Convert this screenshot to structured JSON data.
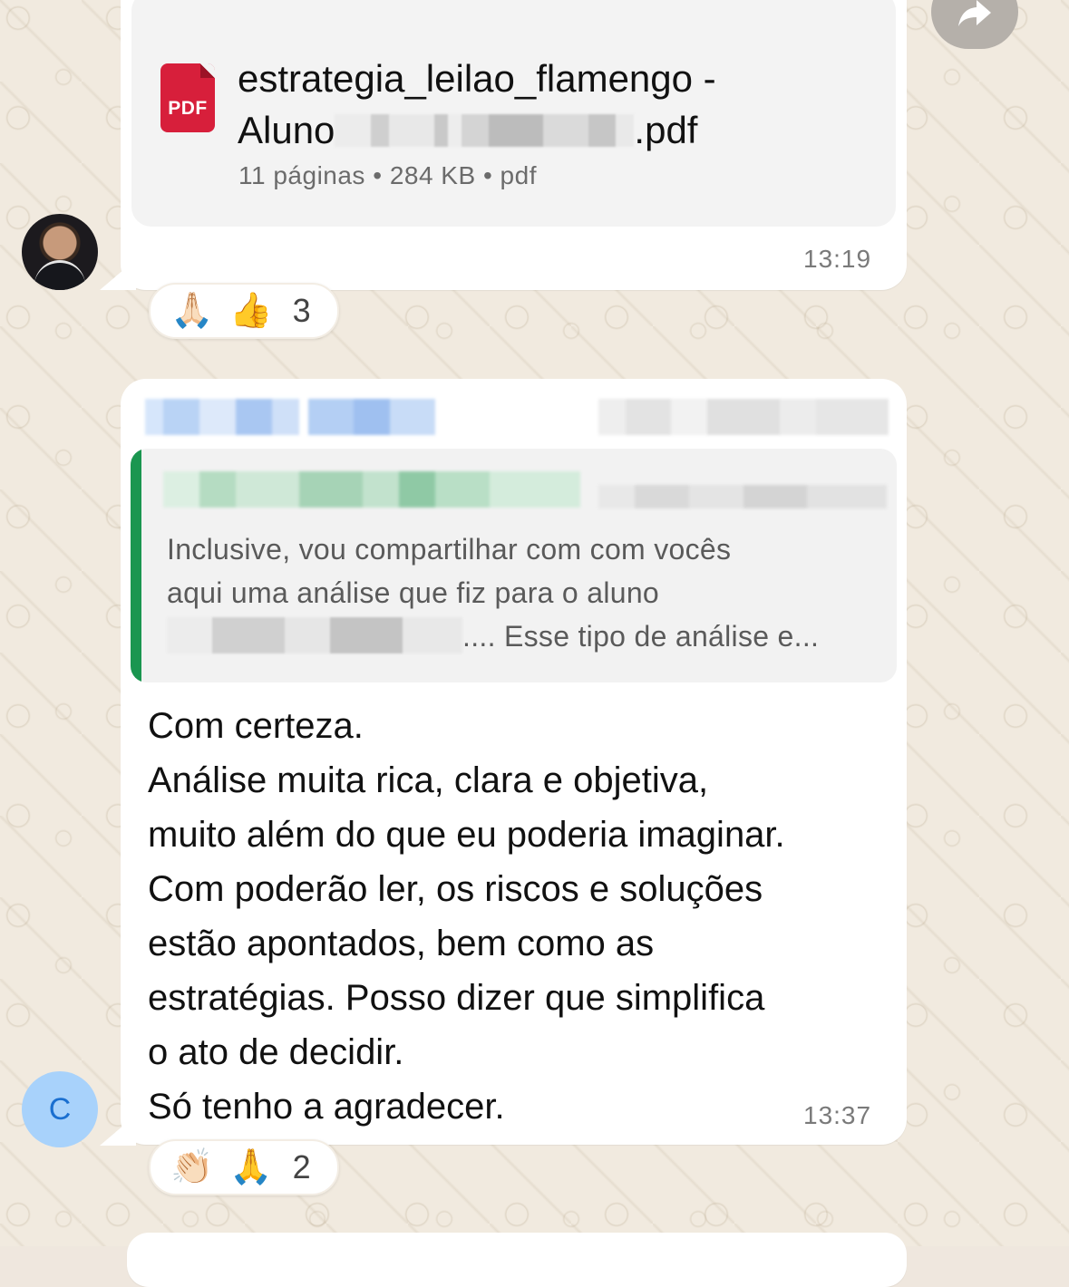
{
  "message1": {
    "file_icon": "pdf-icon",
    "file_icon_label": "PDF",
    "file_name_line1": "estrategia_leilao_flamengo -",
    "file_name_line2_prefix": "Aluno",
    "file_name_line2_suffix": ".pdf",
    "file_pages": "11 páginas",
    "file_size": "284 KB",
    "file_type": "pdf",
    "separator": "•",
    "time": "13:19",
    "reactions": {
      "emojis": [
        "🙏🏻",
        "👍"
      ],
      "count": "3"
    }
  },
  "message2": {
    "quote": {
      "text_line1": "Inclusive, vou compartilhar com com vocês",
      "text_line2": "aqui uma análise que fiz para o aluno",
      "text_line3_suffix": ".... Esse tipo de análise e..."
    },
    "body": "Com certeza.\nAnálise muita rica, clara e objetiva,\nmuito além do que eu poderia imaginar.\nCom poderão ler, os riscos e soluções\nestão apontados, bem como as\nestratégias. Posso dizer que simplifica\no ato de decidir.\nSó tenho a agradecer.",
    "time": "13:37",
    "reactions": {
      "emojis": [
        "👏🏻",
        "🙏"
      ],
      "count": "2"
    },
    "sender_avatar_initial": "C"
  },
  "colors": {
    "quote_accent": "#1a9650",
    "pdf_red": "#d71f3b",
    "avatar_c_bg": "#a8d2fb"
  }
}
